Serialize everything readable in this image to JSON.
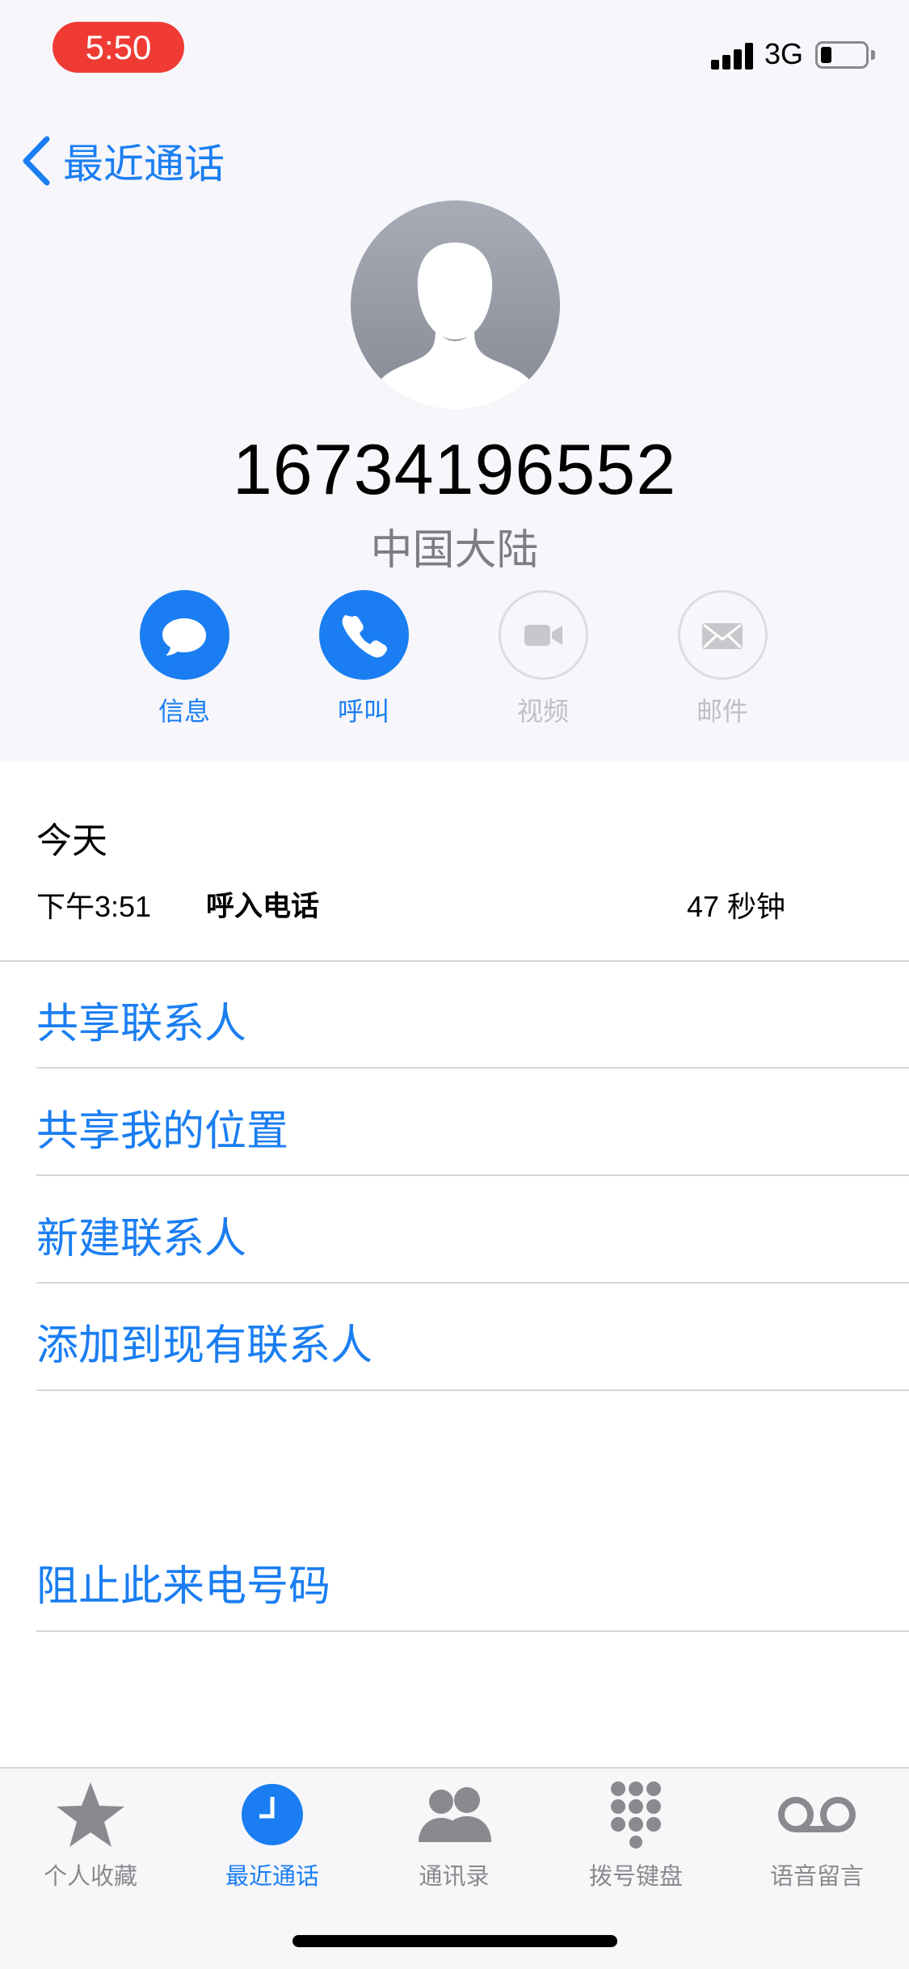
{
  "status_bar": {
    "time": "5:50",
    "network": "3G",
    "battery_level": 0.25
  },
  "nav": {
    "back_label": "最近通话"
  },
  "contact": {
    "number": "16734196552",
    "region": "中国大陆"
  },
  "actions": [
    {
      "label": "信息",
      "icon": "message-bubble-icon",
      "enabled": true
    },
    {
      "label": "呼叫",
      "icon": "phone-icon",
      "enabled": true
    },
    {
      "label": "视频",
      "icon": "video-camera-icon",
      "enabled": false
    },
    {
      "label": "邮件",
      "icon": "envelope-icon",
      "enabled": false
    }
  ],
  "call_log": {
    "day": "今天",
    "entries": [
      {
        "time": "下午3:51",
        "type": "呼入电话",
        "duration": "47 秒钟"
      }
    ]
  },
  "options": [
    {
      "label": "共享联系人"
    },
    {
      "label": "共享我的位置"
    },
    {
      "label": "新建联系人"
    },
    {
      "label": "添加到现有联系人"
    }
  ],
  "block": {
    "label": "阻止此来电号码"
  },
  "tabs": [
    {
      "label": "个人收藏",
      "icon": "star-icon",
      "active": false
    },
    {
      "label": "最近通话",
      "icon": "clock-icon",
      "active": true
    },
    {
      "label": "通讯录",
      "icon": "contacts-icon",
      "active": false
    },
    {
      "label": "拨号键盘",
      "icon": "keypad-icon",
      "active": false
    },
    {
      "label": "语音留言",
      "icon": "voicemail-icon",
      "active": false
    }
  ],
  "colors": {
    "accent": "#1a7ef2",
    "time_pill": "#ef3b34",
    "inactive": "#c0c0c4"
  }
}
